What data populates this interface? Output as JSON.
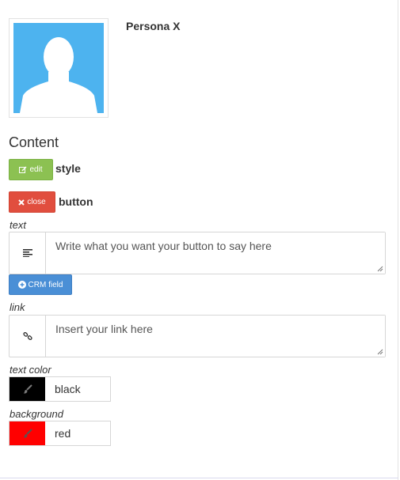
{
  "persona": {
    "name": "Persona X"
  },
  "section": {
    "title": "Content"
  },
  "style_row": {
    "edit_label": "edit",
    "label": "style"
  },
  "button_row": {
    "close_label": "close",
    "label": "button"
  },
  "text_field": {
    "label": "text",
    "placeholder": "Write what you want your button to say here",
    "addon_icon": "align-left-icon"
  },
  "crm_button": {
    "label": "CRM field",
    "icon": "plus-circle-icon"
  },
  "link_field": {
    "label": "link",
    "placeholder": "Insert your link here",
    "addon_icon": "link-icon"
  },
  "text_color": {
    "label": "text color",
    "value": "black",
    "swatch": "#000000",
    "icon": "brush-icon"
  },
  "background": {
    "label": "background",
    "value": "red",
    "swatch": "#ff0000",
    "icon": "brush-icon"
  },
  "colors": {
    "avatar_bg": "#4db3ef",
    "edit_green": "#8cc152",
    "close_red": "#e14e3e",
    "crm_blue": "#4a8fd6"
  }
}
